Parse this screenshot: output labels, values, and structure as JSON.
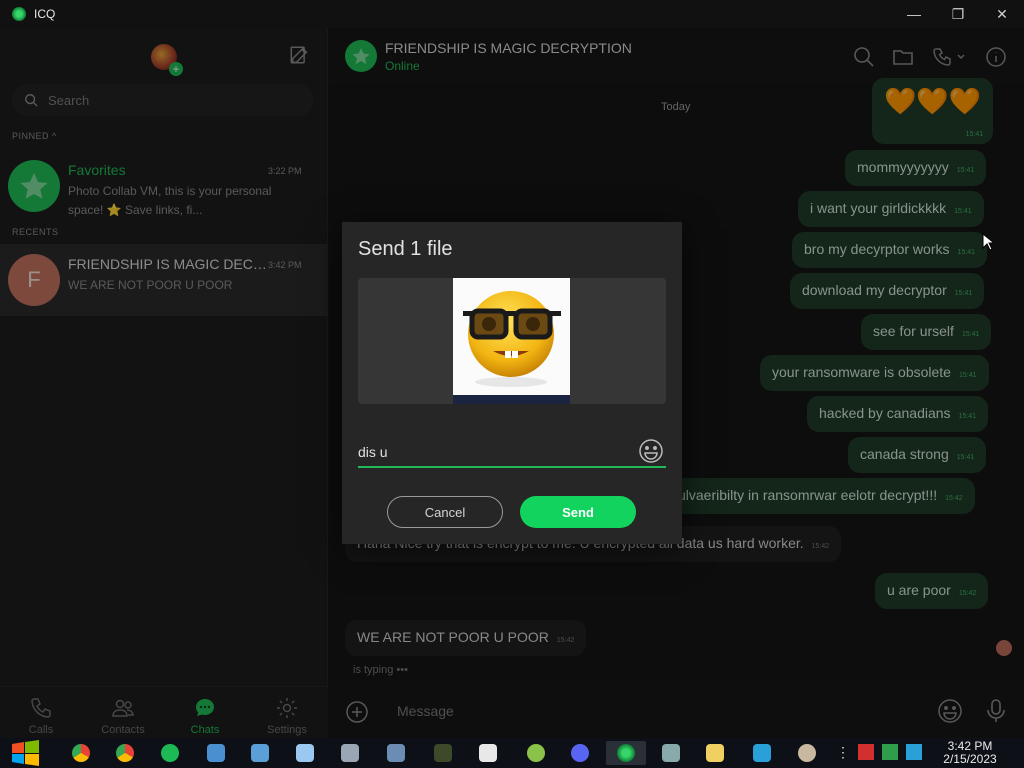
{
  "window": {
    "title": "ICQ",
    "controls": {
      "minimize": "—",
      "restore": "❐",
      "close": "✕"
    }
  },
  "sidebar": {
    "search_placeholder": "Search",
    "pinned_label": "PINNED",
    "recents_label": "RECENTS",
    "chats": [
      {
        "name": "Favorites",
        "time": "3:22 PM",
        "preview": "Photo Collab VM, this is your personal space! ⭐ Save links, fi...",
        "name_color": "#1fb855"
      },
      {
        "name": "FRIENDSHIP IS MAGIC DECRYPTION",
        "time": "3:42 PM",
        "preview": "WE ARE NOT POOR U POOR",
        "initial": "F"
      }
    ],
    "nav": [
      {
        "label": "Calls",
        "icon": "phone-icon"
      },
      {
        "label": "Contacts",
        "icon": "contacts-icon"
      },
      {
        "label": "Chats",
        "icon": "chats-icon"
      },
      {
        "label": "Settings",
        "icon": "gear-icon"
      }
    ]
  },
  "chat": {
    "name": "FRIENDSHIP IS MAGIC DECRYPTION",
    "status": "Online",
    "date_divider": "Today",
    "messages": [
      {
        "dir": "out",
        "text": "🧡🧡🧡",
        "time": "15:41"
      },
      {
        "dir": "out",
        "text": "mommyyyyyyy",
        "time": "15:41"
      },
      {
        "dir": "out",
        "text": "i want your girldickkkk",
        "time": "15:41"
      },
      {
        "dir": "out",
        "text": "bro my decyrptor works",
        "time": "15:41"
      },
      {
        "dir": "out",
        "text": "download my decryptor",
        "time": "15:41"
      },
      {
        "dir": "out",
        "text": "see for urself",
        "time": "15:41"
      },
      {
        "dir": "out",
        "text": "your ransomware is obsolete",
        "time": "15:41"
      },
      {
        "dir": "out",
        "text": "hacked by canadians",
        "time": "15:41"
      },
      {
        "dir": "out",
        "text": "canada strong",
        "time": "15:41"
      },
      {
        "dir": "out",
        "text": "vulvaeribilty in ransomrwar eelotr decrypt!!!",
        "time": "15:42"
      },
      {
        "dir": "in",
        "text": "Haha Nice try that is encrypt to me. U encrypted all data us hard worker.",
        "time": "15:42"
      },
      {
        "dir": "out",
        "text": "u are poor",
        "time": "15:42"
      },
      {
        "dir": "in",
        "text": "WE ARE NOT POOR U POOR",
        "time": "15:42"
      }
    ],
    "typing": "is typing  •••",
    "composer_placeholder": "Message"
  },
  "dialog": {
    "title": "Send 1 file",
    "caption_value": "dis u",
    "cancel_label": "Cancel",
    "send_label": "Send"
  },
  "taskbar": {
    "time": "3:42 PM",
    "date": "2/15/2023"
  },
  "colors": {
    "accent": "#1fb855",
    "send_button": "#12d35d",
    "outgoing_bubble": "#1f3a28",
    "incoming_bubble": "#1f1f1f"
  }
}
